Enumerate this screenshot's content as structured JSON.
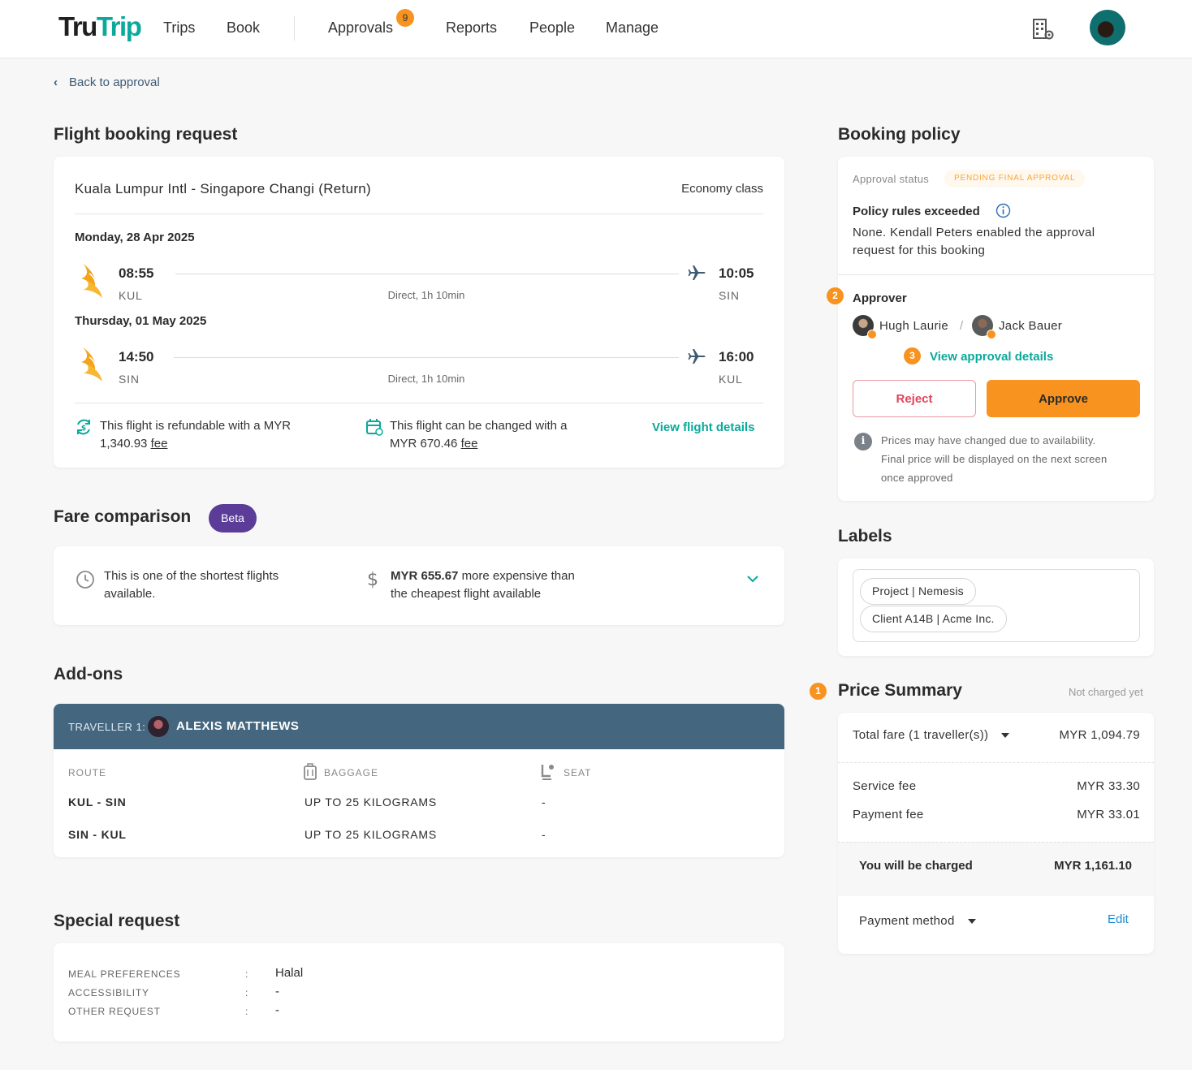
{
  "header": {
    "logo_part1": "Tru",
    "logo_part2": "Trip",
    "nav": [
      "Trips",
      "Book",
      "Approvals",
      "Reports",
      "People",
      "Manage"
    ],
    "approvals_badge": "9"
  },
  "back_link": "Back to approval",
  "flight": {
    "section_title": "Flight booking request",
    "route": "Kuala Lumpur Intl - Singapore Changi (Return)",
    "cabin": "Economy class",
    "legs": [
      {
        "date": "Monday, 28 Apr 2025",
        "dep_time": "08:55",
        "dep_code": "KUL",
        "arr_time": "10:05",
        "arr_code": "SIN",
        "duration": "Direct, 1h 10min"
      },
      {
        "date": "Thursday, 01 May 2025",
        "dep_time": "14:50",
        "dep_code": "SIN",
        "arr_time": "16:00",
        "arr_code": "KUL",
        "duration": "Direct, 1h 10min"
      }
    ],
    "refund_text_1": "This flight is refundable with a MYR",
    "refund_text_2": "1,340.93",
    "refund_fee": "fee",
    "change_text_1": "This flight can be changed with a",
    "change_text_2": "MYR 670.46",
    "change_fee": "fee",
    "view_details": "View flight details"
  },
  "fare": {
    "title": "Fare comparison",
    "badge": "Beta",
    "short_text_1": "This is one of the shortest flights",
    "short_text_2": "available.",
    "price_amount": "MYR 655.67",
    "price_text_1": "more expensive than",
    "price_text_2": "the cheapest flight available"
  },
  "addons": {
    "title": "Add-ons",
    "traveller_label": "TRAVELLER 1:",
    "traveller_name": "ALEXIS MATTHEWS",
    "headers": [
      "ROUTE",
      "BAGGAGE",
      "SEAT"
    ],
    "rows": [
      {
        "route": "KUL - SIN",
        "baggage": "UP TO 25 KILOGRAMS",
        "seat": "-"
      },
      {
        "route": "SIN - KUL",
        "baggage": "UP TO 25 KILOGRAMS",
        "seat": "-"
      }
    ]
  },
  "special": {
    "title": "Special request",
    "rows": [
      {
        "label": "MEAL PREFERENCES",
        "colon": ":",
        "value": "Halal"
      },
      {
        "label": "ACCESSIBILITY",
        "colon": ":",
        "value": "-"
      },
      {
        "label": "OTHER REQUEST",
        "colon": ":",
        "value": "-"
      }
    ]
  },
  "policy": {
    "title": "Booking policy",
    "status_label": "Approval status",
    "status_value": "PENDING FINAL APPROVAL",
    "rules_title": "Policy rules exceeded",
    "rules_text_1": "None. Kendall Peters enabled the approval",
    "rules_text_2": "request for this booking",
    "approver_title": "Approver",
    "approver_step": "2",
    "approver_1": "Hugh Laurie",
    "separator": "/",
    "approver_2": "Jack Bauer",
    "details_step": "3",
    "details_link": "View approval details",
    "reject": "Reject",
    "approve": "Approve",
    "note_1": "Prices may have changed due to availability.",
    "note_2": "Final price will be displayed on the next screen",
    "note_3": "once approved"
  },
  "labels": {
    "title": "Labels",
    "chips": [
      "Project | Nemesis",
      "Client A14B | Acme Inc."
    ]
  },
  "price": {
    "step": "1",
    "title": "Price Summary",
    "not_charged": "Not charged yet",
    "total_label": "Total fare (1 traveller(s))",
    "total_value": "MYR 1,094.79",
    "service_label": "Service fee",
    "service_value": "MYR 33.30",
    "payment_fee_label": "Payment fee",
    "payment_fee_value": "MYR 33.01",
    "charged_label": "You will be charged",
    "charged_value": "MYR 1,161.10",
    "method_label": "Payment method",
    "edit": "Edit"
  },
  "colors": {
    "teal": "#0aa99b",
    "orange": "#f7931e",
    "navy": "#44677f",
    "purple": "#5b3d99",
    "reject_red": "#e0455b"
  }
}
